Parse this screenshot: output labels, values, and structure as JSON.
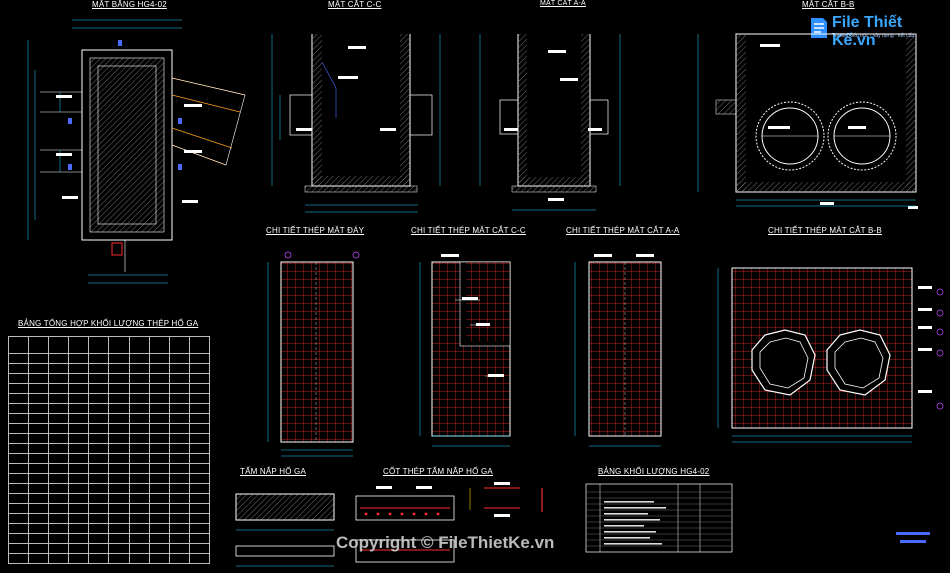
{
  "logo": {
    "brand": "File Thiết Kế.vn",
    "sub": "Tài liệu kiến trúc · xây dựng · kết cấu"
  },
  "watermark": "Copyright © FileThietKe.vn",
  "titles": {
    "mat_bang": "MẶT BẰNG HG4-02",
    "mat_cat_cc": "MẶT CẮT C-C",
    "mat_cat_aa": "MẶT CẮT A-A",
    "mat_cat_bb": "MẶT CẮT B-B",
    "ct_mat_day": "CHI TIẾT THÉP MẶT ĐÁY",
    "ct_cc": "CHI TIẾT THÉP MẶT CẮT C-C",
    "ct_aa": "CHI TIẾT THÉP MẶT CẮT A-A",
    "ct_bb": "CHI TIẾT THÉP MẶT CẮT B-B",
    "bang_thep": "BẢNG TỔNG HỢP KHỐI LƯỢNG THÉP HỐ GA",
    "tam_nap": "TẤM NẮP HỐ GA",
    "cot_thep_nap": "CỐT THÉP TẤM NẮP HỐ GA",
    "bang_kl": "BẢNG KHỐI LƯỢNG HG4-02"
  },
  "colors": {
    "background": "#000000",
    "rebar": "#ff2a2a",
    "dimension": "#22d3ff",
    "outline": "#ffffff",
    "hatch": "#9a9a9a",
    "note": "#ffd400",
    "link": "#4b6bff"
  }
}
